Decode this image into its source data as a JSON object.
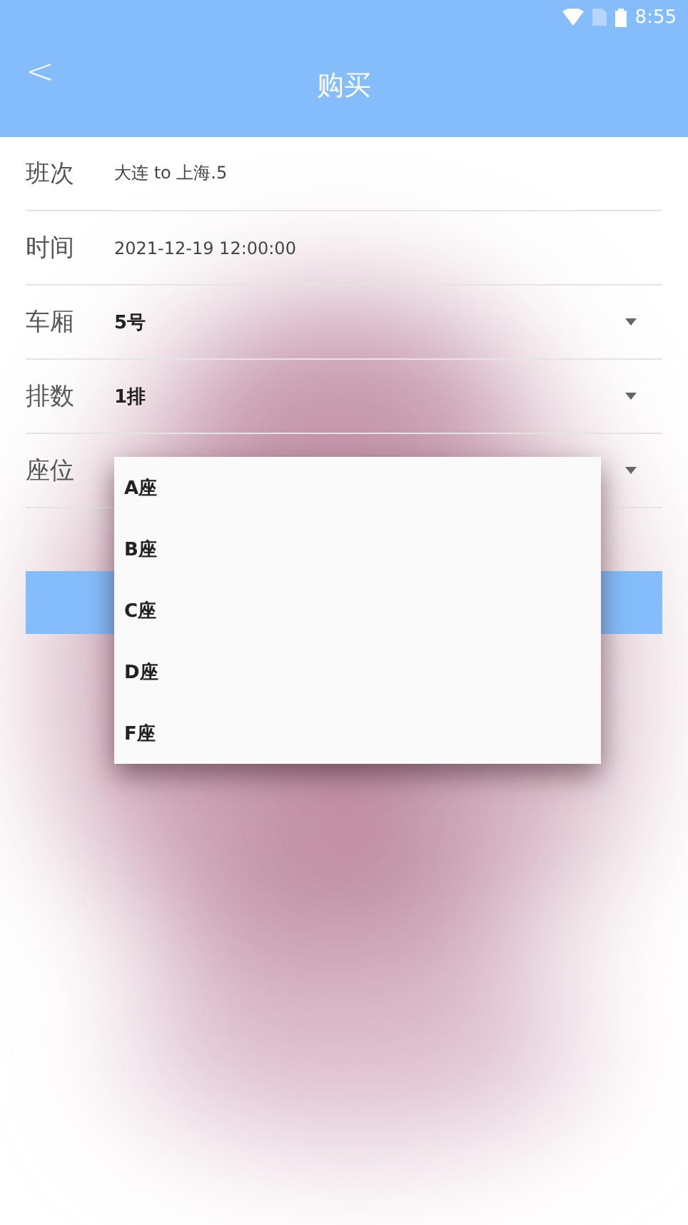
{
  "status_bar": {
    "time": "8:55"
  },
  "header": {
    "back": "<",
    "title": "购买"
  },
  "fields": [
    {
      "label": "班次",
      "kind": "text",
      "value": "大连 to 上海.5"
    },
    {
      "label": "时间",
      "kind": "text",
      "value": "2021-12-19 12:00:00"
    },
    {
      "label": "车厢",
      "kind": "select",
      "value": "5号"
    },
    {
      "label": "排数",
      "kind": "select",
      "value": "1排"
    },
    {
      "label": "座位",
      "kind": "select"
    }
  ],
  "dropdown": {
    "options": [
      "A座",
      "B座",
      "C座",
      "D座",
      "F座"
    ]
  }
}
